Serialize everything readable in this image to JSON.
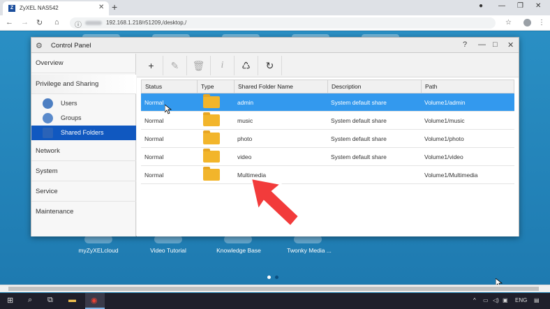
{
  "browser": {
    "tab_title": "ZyXEL NAS542",
    "tab_favicon": "Z",
    "url": "192.168.1.218/r51209,/desktop,/"
  },
  "window": {
    "title": "Control Panel"
  },
  "sidebar": {
    "overview": "Overview",
    "privilege": "Privilege and Sharing",
    "users": "Users",
    "groups": "Groups",
    "shared_folders": "Shared Folders",
    "network": "Network",
    "system": "System",
    "service": "Service",
    "maintenance": "Maintenance"
  },
  "toolbar": {
    "add": "+",
    "edit": "✎",
    "delete": "🗑",
    "info": "i",
    "recycle": "♺",
    "refresh": "↻"
  },
  "table": {
    "headers": [
      "Status",
      "Type",
      "Shared Folder Name",
      "Description",
      "Path"
    ],
    "rows": [
      {
        "status": "Normal",
        "name": "admin",
        "description": "System default share",
        "path": "Volume1/admin"
      },
      {
        "status": "Normal",
        "name": "music",
        "description": "System default share",
        "path": "Volume1/music"
      },
      {
        "status": "Normal",
        "name": "photo",
        "description": "System default share",
        "path": "Volume1/photo"
      },
      {
        "status": "Normal",
        "name": "video",
        "description": "System default share",
        "path": "Volume1/video"
      },
      {
        "status": "Normal",
        "name": "Multimedia",
        "description": "",
        "path": "Volume1/Multimedia"
      }
    ]
  },
  "desktop": {
    "labels": [
      "myZyXELcloud",
      "Video Tutorial",
      "Knowledge Base",
      "Twonky Media ..."
    ]
  },
  "taskbar": {
    "lang": "ENG"
  },
  "colors": {
    "selection": "#3399ee",
    "active_nav": "#1058c0",
    "folder": "#f2b52b",
    "arrow": "#f23b3b"
  }
}
